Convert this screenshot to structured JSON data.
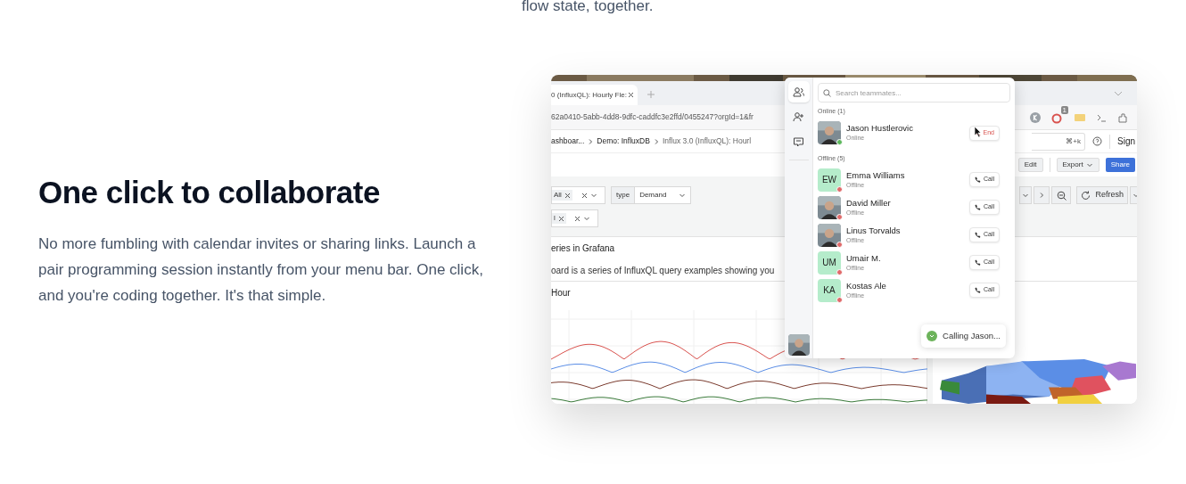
{
  "intro_tail": "flow state, together.",
  "section": {
    "title": "One click to collaborate",
    "body": "No more fumbling with calendar invites or sharing links. Launch a pair programming session instantly from your menu bar. One click, and you're coding together. It's that simple."
  },
  "screenshot": {
    "browser": {
      "tab": "0 (InfluxQL): Hourly Fle:",
      "url": "62a0410-5abb-4dd8-9dfc-caddfc3e2ffd/0455247?orgId=1&fr",
      "extension_badge": "1"
    },
    "grafana": {
      "breadcrumbs": [
        "ashboar...",
        "Demo: InfluxDB",
        "Influx 3.0 (InfluxQL): Hourl"
      ],
      "search_shortcut": "⌘+k",
      "sign_in": "Sign",
      "actions": [
        {
          "label": "Edit",
          "kind": "plain"
        },
        {
          "label": "Export",
          "kind": "menu"
        },
        {
          "label": "Share",
          "kind": "primary"
        }
      ],
      "variables": [
        {
          "kind": "chip",
          "chip": "All"
        },
        {
          "kind": "labelled",
          "label": "type",
          "value": "Demand"
        },
        {
          "kind": "chip",
          "chip": "l"
        }
      ],
      "refresh": "Refresh",
      "text_panel": {
        "title": "eries in Grafana",
        "body": "oard is a series of InfluxQL query examples showing you"
      },
      "chart_panel": {
        "title": "Hour"
      }
    },
    "teammates": {
      "rail": [
        {
          "kind": "people",
          "selected": true
        },
        {
          "kind": "add",
          "selected": false
        },
        {
          "kind": "chat",
          "selected": false
        }
      ],
      "search": {
        "placeholder": "Search teammates..."
      },
      "groups": [
        {
          "title": "Online (1)",
          "members": [
            {
              "name": "Jason Hustlerovic",
              "status": "Online",
              "color": "#5cb85c",
              "button": {
                "kind": "end",
                "label": "End"
              }
            }
          ]
        },
        {
          "title": "Offline (5)",
          "members": [
            {
              "name": "Emma Williams",
              "status": "Offline",
              "color": "#e06a6a",
              "kind": "initials",
              "initials": "EW",
              "button": {
                "kind": "call",
                "label": "Call"
              }
            },
            {
              "name": "David Miller",
              "status": "Offline",
              "color": "#e06a6a",
              "button": {
                "kind": "call",
                "label": "Call"
              }
            },
            {
              "name": "Linus Torvalds",
              "status": "Offline",
              "color": "#e06a6a",
              "button": {
                "kind": "call",
                "label": "Call"
              }
            },
            {
              "name": "Umair M.",
              "status": "Offline",
              "color": "#e06a6a",
              "kind": "initials",
              "initials": "UM",
              "button": {
                "kind": "call",
                "label": "Call"
              }
            },
            {
              "name": "Kostas Ale",
              "status": "Offline",
              "color": "#e06a6a",
              "kind": "initials",
              "initials": "KA",
              "button": {
                "kind": "call",
                "label": "Call"
              }
            }
          ]
        }
      ],
      "toast": "Calling Jason..."
    }
  }
}
